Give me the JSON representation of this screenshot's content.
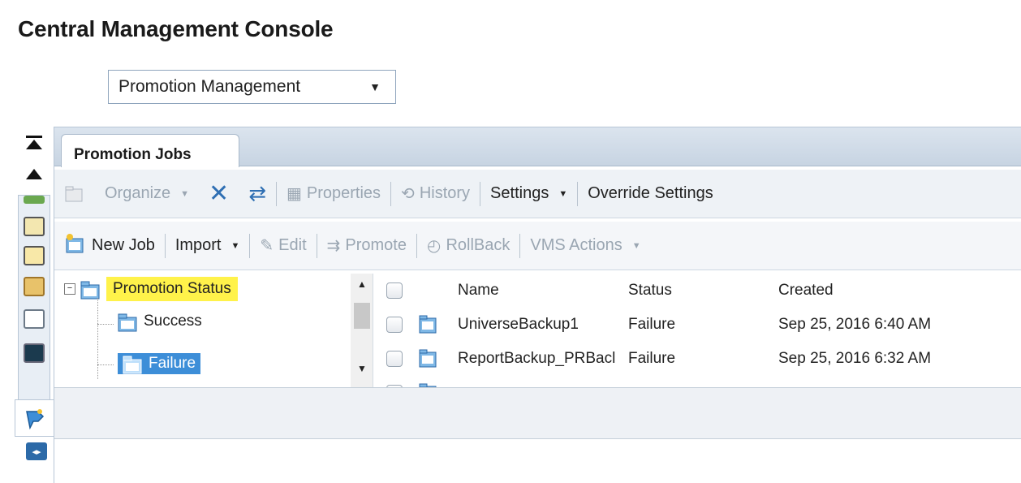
{
  "app": {
    "title": "Central Management Console"
  },
  "module_select": {
    "value": "Promotion Management"
  },
  "tabs": [
    {
      "label": "Promotion Jobs"
    }
  ],
  "toolbar1": {
    "organize": "Organize",
    "properties": "Properties",
    "history": "History",
    "settings": "Settings",
    "override": "Override Settings"
  },
  "toolbar2": {
    "new_job": "New Job",
    "import": "Import",
    "edit": "Edit",
    "promote": "Promote",
    "rollback": "RollBack",
    "vms_actions": "VMS Actions"
  },
  "tree": {
    "root": "Promotion Status",
    "children": [
      "Success",
      "Failure"
    ]
  },
  "grid": {
    "columns": [
      "Name",
      "Status",
      "Created"
    ],
    "rows": [
      {
        "name": "UniverseBackup1",
        "status": "Failure",
        "created": "Sep 25, 2016 6:40 AM"
      },
      {
        "name": "ReportBackup_PRBacl",
        "status": "Failure",
        "created": "Sep 25, 2016 6:32 AM"
      }
    ]
  },
  "colors": {
    "highlight": "#fff24a",
    "selection": "#3d8ed8",
    "accent": "#2c6aa8"
  }
}
